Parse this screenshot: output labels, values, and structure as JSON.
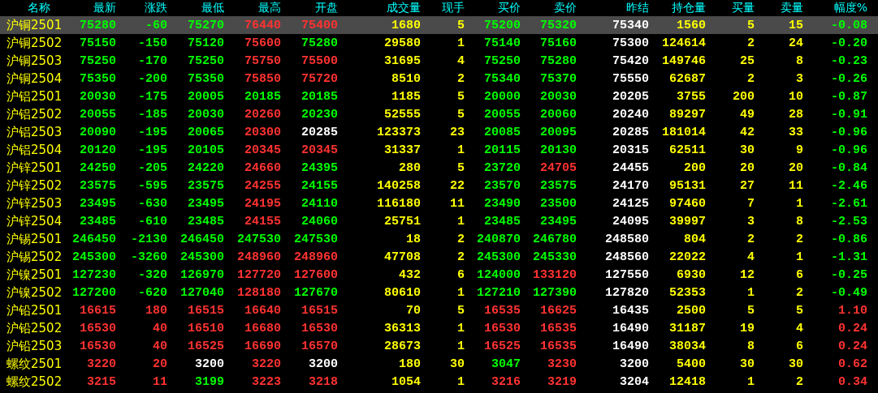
{
  "columns": [
    {
      "label": "名称"
    },
    {
      "label": "最新"
    },
    {
      "label": "涨跌"
    },
    {
      "label": "最低"
    },
    {
      "label": "最高"
    },
    {
      "label": "开盘"
    },
    {
      "label": "成交量"
    },
    {
      "label": "现手"
    },
    {
      "label": "买价"
    },
    {
      "label": "卖价"
    },
    {
      "label": "昨结"
    },
    {
      "label": "持仓量"
    },
    {
      "label": "买量"
    },
    {
      "label": "卖量"
    },
    {
      "label": "幅度%"
    }
  ],
  "rows": [
    {
      "selected": true,
      "cells": [
        {
          "text": "沪铜2501"
        },
        {
          "text": "75280",
          "color": "#00ff00"
        },
        {
          "text": "-60",
          "color": "#00ff00"
        },
        {
          "text": "75270",
          "color": "#00ff00"
        },
        {
          "text": "76440",
          "color": "#ff3232"
        },
        {
          "text": "75400",
          "color": "#ff3232"
        },
        {
          "text": "1680",
          "color": "#ffff00"
        },
        {
          "text": "5",
          "color": "#ffff00"
        },
        {
          "text": "75200",
          "color": "#00ff00"
        },
        {
          "text": "75320",
          "color": "#00ff00"
        },
        {
          "text": "75340",
          "color": "#ffffff"
        },
        {
          "text": "1560",
          "color": "#ffff00"
        },
        {
          "text": "5",
          "color": "#ffff00"
        },
        {
          "text": "15",
          "color": "#ffff00"
        },
        {
          "text": "-0.08",
          "color": "#00ff00"
        }
      ]
    },
    {
      "selected": false,
      "cells": [
        {
          "text": "沪铜2502"
        },
        {
          "text": "75150",
          "color": "#00ff00"
        },
        {
          "text": "-150",
          "color": "#00ff00"
        },
        {
          "text": "75120",
          "color": "#00ff00"
        },
        {
          "text": "75600",
          "color": "#ff3232"
        },
        {
          "text": "75280",
          "color": "#00ff00"
        },
        {
          "text": "29580",
          "color": "#ffff00"
        },
        {
          "text": "1",
          "color": "#ffff00"
        },
        {
          "text": "75140",
          "color": "#00ff00"
        },
        {
          "text": "75160",
          "color": "#00ff00"
        },
        {
          "text": "75300",
          "color": "#ffffff"
        },
        {
          "text": "124614",
          "color": "#ffff00"
        },
        {
          "text": "2",
          "color": "#ffff00"
        },
        {
          "text": "24",
          "color": "#ffff00"
        },
        {
          "text": "-0.20",
          "color": "#00ff00"
        }
      ]
    },
    {
      "selected": false,
      "cells": [
        {
          "text": "沪铜2503"
        },
        {
          "text": "75250",
          "color": "#00ff00"
        },
        {
          "text": "-170",
          "color": "#00ff00"
        },
        {
          "text": "75250",
          "color": "#00ff00"
        },
        {
          "text": "75750",
          "color": "#ff3232"
        },
        {
          "text": "75500",
          "color": "#ff3232"
        },
        {
          "text": "31695",
          "color": "#ffff00"
        },
        {
          "text": "4",
          "color": "#ffff00"
        },
        {
          "text": "75250",
          "color": "#00ff00"
        },
        {
          "text": "75280",
          "color": "#00ff00"
        },
        {
          "text": "75420",
          "color": "#ffffff"
        },
        {
          "text": "149746",
          "color": "#ffff00"
        },
        {
          "text": "25",
          "color": "#ffff00"
        },
        {
          "text": "8",
          "color": "#ffff00"
        },
        {
          "text": "-0.23",
          "color": "#00ff00"
        }
      ]
    },
    {
      "selected": false,
      "cells": [
        {
          "text": "沪铜2504"
        },
        {
          "text": "75350",
          "color": "#00ff00"
        },
        {
          "text": "-200",
          "color": "#00ff00"
        },
        {
          "text": "75350",
          "color": "#00ff00"
        },
        {
          "text": "75850",
          "color": "#ff3232"
        },
        {
          "text": "75720",
          "color": "#ff3232"
        },
        {
          "text": "8510",
          "color": "#ffff00"
        },
        {
          "text": "2",
          "color": "#ffff00"
        },
        {
          "text": "75340",
          "color": "#00ff00"
        },
        {
          "text": "75370",
          "color": "#00ff00"
        },
        {
          "text": "75550",
          "color": "#ffffff"
        },
        {
          "text": "62687",
          "color": "#ffff00"
        },
        {
          "text": "2",
          "color": "#ffff00"
        },
        {
          "text": "3",
          "color": "#ffff00"
        },
        {
          "text": "-0.26",
          "color": "#00ff00"
        }
      ]
    },
    {
      "selected": false,
      "cells": [
        {
          "text": "沪铝2501"
        },
        {
          "text": "20030",
          "color": "#00ff00"
        },
        {
          "text": "-175",
          "color": "#00ff00"
        },
        {
          "text": "20005",
          "color": "#00ff00"
        },
        {
          "text": "20185",
          "color": "#00ff00"
        },
        {
          "text": "20185",
          "color": "#00ff00"
        },
        {
          "text": "1185",
          "color": "#ffff00"
        },
        {
          "text": "5",
          "color": "#ffff00"
        },
        {
          "text": "20000",
          "color": "#00ff00"
        },
        {
          "text": "20030",
          "color": "#00ff00"
        },
        {
          "text": "20205",
          "color": "#ffffff"
        },
        {
          "text": "3755",
          "color": "#ffff00"
        },
        {
          "text": "200",
          "color": "#ffff00"
        },
        {
          "text": "10",
          "color": "#ffff00"
        },
        {
          "text": "-0.87",
          "color": "#00ff00"
        }
      ]
    },
    {
      "selected": false,
      "cells": [
        {
          "text": "沪铝2502"
        },
        {
          "text": "20055",
          "color": "#00ff00"
        },
        {
          "text": "-185",
          "color": "#00ff00"
        },
        {
          "text": "20030",
          "color": "#00ff00"
        },
        {
          "text": "20260",
          "color": "#ff3232"
        },
        {
          "text": "20230",
          "color": "#00ff00"
        },
        {
          "text": "52555",
          "color": "#ffff00"
        },
        {
          "text": "5",
          "color": "#ffff00"
        },
        {
          "text": "20055",
          "color": "#00ff00"
        },
        {
          "text": "20060",
          "color": "#00ff00"
        },
        {
          "text": "20240",
          "color": "#ffffff"
        },
        {
          "text": "89297",
          "color": "#ffff00"
        },
        {
          "text": "49",
          "color": "#ffff00"
        },
        {
          "text": "28",
          "color": "#ffff00"
        },
        {
          "text": "-0.91",
          "color": "#00ff00"
        }
      ]
    },
    {
      "selected": false,
      "cells": [
        {
          "text": "沪铝2503"
        },
        {
          "text": "20090",
          "color": "#00ff00"
        },
        {
          "text": "-195",
          "color": "#00ff00"
        },
        {
          "text": "20065",
          "color": "#00ff00"
        },
        {
          "text": "20300",
          "color": "#ff3232"
        },
        {
          "text": "20285",
          "color": "#ffffff"
        },
        {
          "text": "123373",
          "color": "#ffff00"
        },
        {
          "text": "23",
          "color": "#ffff00"
        },
        {
          "text": "20085",
          "color": "#00ff00"
        },
        {
          "text": "20095",
          "color": "#00ff00"
        },
        {
          "text": "20285",
          "color": "#ffffff"
        },
        {
          "text": "181014",
          "color": "#ffff00"
        },
        {
          "text": "42",
          "color": "#ffff00"
        },
        {
          "text": "33",
          "color": "#ffff00"
        },
        {
          "text": "-0.96",
          "color": "#00ff00"
        }
      ]
    },
    {
      "selected": false,
      "cells": [
        {
          "text": "沪铝2504"
        },
        {
          "text": "20120",
          "color": "#00ff00"
        },
        {
          "text": "-195",
          "color": "#00ff00"
        },
        {
          "text": "20105",
          "color": "#00ff00"
        },
        {
          "text": "20345",
          "color": "#ff3232"
        },
        {
          "text": "20345",
          "color": "#ff3232"
        },
        {
          "text": "31337",
          "color": "#ffff00"
        },
        {
          "text": "1",
          "color": "#ffff00"
        },
        {
          "text": "20115",
          "color": "#00ff00"
        },
        {
          "text": "20130",
          "color": "#00ff00"
        },
        {
          "text": "20315",
          "color": "#ffffff"
        },
        {
          "text": "62511",
          "color": "#ffff00"
        },
        {
          "text": "30",
          "color": "#ffff00"
        },
        {
          "text": "9",
          "color": "#ffff00"
        },
        {
          "text": "-0.96",
          "color": "#00ff00"
        }
      ]
    },
    {
      "selected": false,
      "cells": [
        {
          "text": "沪锌2501"
        },
        {
          "text": "24250",
          "color": "#00ff00"
        },
        {
          "text": "-205",
          "color": "#00ff00"
        },
        {
          "text": "24220",
          "color": "#00ff00"
        },
        {
          "text": "24660",
          "color": "#ff3232"
        },
        {
          "text": "24395",
          "color": "#00ff00"
        },
        {
          "text": "280",
          "color": "#ffff00"
        },
        {
          "text": "5",
          "color": "#ffff00"
        },
        {
          "text": "23720",
          "color": "#00ff00"
        },
        {
          "text": "24705",
          "color": "#ff3232"
        },
        {
          "text": "24455",
          "color": "#ffffff"
        },
        {
          "text": "200",
          "color": "#ffff00"
        },
        {
          "text": "20",
          "color": "#ffff00"
        },
        {
          "text": "20",
          "color": "#ffff00"
        },
        {
          "text": "-0.84",
          "color": "#00ff00"
        }
      ]
    },
    {
      "selected": false,
      "cells": [
        {
          "text": "沪锌2502"
        },
        {
          "text": "23575",
          "color": "#00ff00"
        },
        {
          "text": "-595",
          "color": "#00ff00"
        },
        {
          "text": "23575",
          "color": "#00ff00"
        },
        {
          "text": "24255",
          "color": "#ff3232"
        },
        {
          "text": "24155",
          "color": "#00ff00"
        },
        {
          "text": "140258",
          "color": "#ffff00"
        },
        {
          "text": "22",
          "color": "#ffff00"
        },
        {
          "text": "23570",
          "color": "#00ff00"
        },
        {
          "text": "23575",
          "color": "#00ff00"
        },
        {
          "text": "24170",
          "color": "#ffffff"
        },
        {
          "text": "95131",
          "color": "#ffff00"
        },
        {
          "text": "27",
          "color": "#ffff00"
        },
        {
          "text": "11",
          "color": "#ffff00"
        },
        {
          "text": "-2.46",
          "color": "#00ff00"
        }
      ]
    },
    {
      "selected": false,
      "cells": [
        {
          "text": "沪锌2503"
        },
        {
          "text": "23495",
          "color": "#00ff00"
        },
        {
          "text": "-630",
          "color": "#00ff00"
        },
        {
          "text": "23495",
          "color": "#00ff00"
        },
        {
          "text": "24195",
          "color": "#ff3232"
        },
        {
          "text": "24110",
          "color": "#00ff00"
        },
        {
          "text": "116180",
          "color": "#ffff00"
        },
        {
          "text": "11",
          "color": "#ffff00"
        },
        {
          "text": "23490",
          "color": "#00ff00"
        },
        {
          "text": "23500",
          "color": "#00ff00"
        },
        {
          "text": "24125",
          "color": "#ffffff"
        },
        {
          "text": "97460",
          "color": "#ffff00"
        },
        {
          "text": "7",
          "color": "#ffff00"
        },
        {
          "text": "1",
          "color": "#ffff00"
        },
        {
          "text": "-2.61",
          "color": "#00ff00"
        }
      ]
    },
    {
      "selected": false,
      "cells": [
        {
          "text": "沪锌2504"
        },
        {
          "text": "23485",
          "color": "#00ff00"
        },
        {
          "text": "-610",
          "color": "#00ff00"
        },
        {
          "text": "23485",
          "color": "#00ff00"
        },
        {
          "text": "24155",
          "color": "#ff3232"
        },
        {
          "text": "24060",
          "color": "#00ff00"
        },
        {
          "text": "25751",
          "color": "#ffff00"
        },
        {
          "text": "1",
          "color": "#ffff00"
        },
        {
          "text": "23485",
          "color": "#00ff00"
        },
        {
          "text": "23495",
          "color": "#00ff00"
        },
        {
          "text": "24095",
          "color": "#ffffff"
        },
        {
          "text": "39997",
          "color": "#ffff00"
        },
        {
          "text": "3",
          "color": "#ffff00"
        },
        {
          "text": "8",
          "color": "#ffff00"
        },
        {
          "text": "-2.53",
          "color": "#00ff00"
        }
      ]
    },
    {
      "selected": false,
      "cells": [
        {
          "text": "沪锡2501"
        },
        {
          "text": "246450",
          "color": "#00ff00"
        },
        {
          "text": "-2130",
          "color": "#00ff00"
        },
        {
          "text": "246450",
          "color": "#00ff00"
        },
        {
          "text": "247530",
          "color": "#00ff00"
        },
        {
          "text": "247530",
          "color": "#00ff00"
        },
        {
          "text": "18",
          "color": "#ffff00"
        },
        {
          "text": "2",
          "color": "#ffff00"
        },
        {
          "text": "240870",
          "color": "#00ff00"
        },
        {
          "text": "246780",
          "color": "#00ff00"
        },
        {
          "text": "248580",
          "color": "#ffffff"
        },
        {
          "text": "804",
          "color": "#ffff00"
        },
        {
          "text": "2",
          "color": "#ffff00"
        },
        {
          "text": "2",
          "color": "#ffff00"
        },
        {
          "text": "-0.86",
          "color": "#00ff00"
        }
      ]
    },
    {
      "selected": false,
      "cells": [
        {
          "text": "沪锡2502"
        },
        {
          "text": "245300",
          "color": "#00ff00"
        },
        {
          "text": "-3260",
          "color": "#00ff00"
        },
        {
          "text": "245300",
          "color": "#00ff00"
        },
        {
          "text": "248960",
          "color": "#ff3232"
        },
        {
          "text": "248960",
          "color": "#ff3232"
        },
        {
          "text": "47708",
          "color": "#ffff00"
        },
        {
          "text": "2",
          "color": "#ffff00"
        },
        {
          "text": "245300",
          "color": "#00ff00"
        },
        {
          "text": "245330",
          "color": "#00ff00"
        },
        {
          "text": "248560",
          "color": "#ffffff"
        },
        {
          "text": "22022",
          "color": "#ffff00"
        },
        {
          "text": "4",
          "color": "#ffff00"
        },
        {
          "text": "1",
          "color": "#ffff00"
        },
        {
          "text": "-1.31",
          "color": "#00ff00"
        }
      ]
    },
    {
      "selected": false,
      "cells": [
        {
          "text": "沪镍2501"
        },
        {
          "text": "127230",
          "color": "#00ff00"
        },
        {
          "text": "-320",
          "color": "#00ff00"
        },
        {
          "text": "126970",
          "color": "#00ff00"
        },
        {
          "text": "127720",
          "color": "#ff3232"
        },
        {
          "text": "127600",
          "color": "#ff3232"
        },
        {
          "text": "432",
          "color": "#ffff00"
        },
        {
          "text": "6",
          "color": "#ffff00"
        },
        {
          "text": "124000",
          "color": "#00ff00"
        },
        {
          "text": "133120",
          "color": "#ff3232"
        },
        {
          "text": "127550",
          "color": "#ffffff"
        },
        {
          "text": "6930",
          "color": "#ffff00"
        },
        {
          "text": "12",
          "color": "#ffff00"
        },
        {
          "text": "6",
          "color": "#ffff00"
        },
        {
          "text": "-0.25",
          "color": "#00ff00"
        }
      ]
    },
    {
      "selected": false,
      "cells": [
        {
          "text": "沪镍2502"
        },
        {
          "text": "127200",
          "color": "#00ff00"
        },
        {
          "text": "-620",
          "color": "#00ff00"
        },
        {
          "text": "127040",
          "color": "#00ff00"
        },
        {
          "text": "128180",
          "color": "#ff3232"
        },
        {
          "text": "127670",
          "color": "#00ff00"
        },
        {
          "text": "80610",
          "color": "#ffff00"
        },
        {
          "text": "1",
          "color": "#ffff00"
        },
        {
          "text": "127210",
          "color": "#00ff00"
        },
        {
          "text": "127390",
          "color": "#00ff00"
        },
        {
          "text": "127820",
          "color": "#ffffff"
        },
        {
          "text": "52353",
          "color": "#ffff00"
        },
        {
          "text": "1",
          "color": "#ffff00"
        },
        {
          "text": "2",
          "color": "#ffff00"
        },
        {
          "text": "-0.49",
          "color": "#00ff00"
        }
      ]
    },
    {
      "selected": false,
      "cells": [
        {
          "text": "沪铅2501"
        },
        {
          "text": "16615",
          "color": "#ff3232"
        },
        {
          "text": "180",
          "color": "#ff3232"
        },
        {
          "text": "16515",
          "color": "#ff3232"
        },
        {
          "text": "16640",
          "color": "#ff3232"
        },
        {
          "text": "16515",
          "color": "#ff3232"
        },
        {
          "text": "70",
          "color": "#ffff00"
        },
        {
          "text": "5",
          "color": "#ffff00"
        },
        {
          "text": "16535",
          "color": "#ff3232"
        },
        {
          "text": "16625",
          "color": "#ff3232"
        },
        {
          "text": "16435",
          "color": "#ffffff"
        },
        {
          "text": "2500",
          "color": "#ffff00"
        },
        {
          "text": "5",
          "color": "#ffff00"
        },
        {
          "text": "5",
          "color": "#ffff00"
        },
        {
          "text": "1.10",
          "color": "#ff3232"
        }
      ]
    },
    {
      "selected": false,
      "cells": [
        {
          "text": "沪铅2502"
        },
        {
          "text": "16530",
          "color": "#ff3232"
        },
        {
          "text": "40",
          "color": "#ff3232"
        },
        {
          "text": "16510",
          "color": "#ff3232"
        },
        {
          "text": "16680",
          "color": "#ff3232"
        },
        {
          "text": "16530",
          "color": "#ff3232"
        },
        {
          "text": "36313",
          "color": "#ffff00"
        },
        {
          "text": "1",
          "color": "#ffff00"
        },
        {
          "text": "16530",
          "color": "#ff3232"
        },
        {
          "text": "16535",
          "color": "#ff3232"
        },
        {
          "text": "16490",
          "color": "#ffffff"
        },
        {
          "text": "31187",
          "color": "#ffff00"
        },
        {
          "text": "19",
          "color": "#ffff00"
        },
        {
          "text": "4",
          "color": "#ffff00"
        },
        {
          "text": "0.24",
          "color": "#ff3232"
        }
      ]
    },
    {
      "selected": false,
      "cells": [
        {
          "text": "沪铅2503"
        },
        {
          "text": "16530",
          "color": "#ff3232"
        },
        {
          "text": "40",
          "color": "#ff3232"
        },
        {
          "text": "16525",
          "color": "#ff3232"
        },
        {
          "text": "16690",
          "color": "#ff3232"
        },
        {
          "text": "16570",
          "color": "#ff3232"
        },
        {
          "text": "28673",
          "color": "#ffff00"
        },
        {
          "text": "1",
          "color": "#ffff00"
        },
        {
          "text": "16525",
          "color": "#ff3232"
        },
        {
          "text": "16535",
          "color": "#ff3232"
        },
        {
          "text": "16490",
          "color": "#ffffff"
        },
        {
          "text": "38034",
          "color": "#ffff00"
        },
        {
          "text": "8",
          "color": "#ffff00"
        },
        {
          "text": "6",
          "color": "#ffff00"
        },
        {
          "text": "0.24",
          "color": "#ff3232"
        }
      ]
    },
    {
      "selected": false,
      "cells": [
        {
          "text": "螺纹2501"
        },
        {
          "text": "3220",
          "color": "#ff3232"
        },
        {
          "text": "20",
          "color": "#ff3232"
        },
        {
          "text": "3200",
          "color": "#ffffff"
        },
        {
          "text": "3220",
          "color": "#ff3232"
        },
        {
          "text": "3200",
          "color": "#ffffff"
        },
        {
          "text": "180",
          "color": "#ffff00"
        },
        {
          "text": "30",
          "color": "#ffff00"
        },
        {
          "text": "3047",
          "color": "#00ff00"
        },
        {
          "text": "3230",
          "color": "#ff3232"
        },
        {
          "text": "3200",
          "color": "#ffffff"
        },
        {
          "text": "5400",
          "color": "#ffff00"
        },
        {
          "text": "30",
          "color": "#ffff00"
        },
        {
          "text": "30",
          "color": "#ffff00"
        },
        {
          "text": "0.62",
          "color": "#ff3232"
        }
      ]
    },
    {
      "selected": false,
      "cells": [
        {
          "text": "螺纹2502"
        },
        {
          "text": "3215",
          "color": "#ff3232"
        },
        {
          "text": "11",
          "color": "#ff3232"
        },
        {
          "text": "3199",
          "color": "#00ff00"
        },
        {
          "text": "3223",
          "color": "#ff3232"
        },
        {
          "text": "3218",
          "color": "#ff3232"
        },
        {
          "text": "1054",
          "color": "#ffff00"
        },
        {
          "text": "1",
          "color": "#ffff00"
        },
        {
          "text": "3216",
          "color": "#ff3232"
        },
        {
          "text": "3219",
          "color": "#ff3232"
        },
        {
          "text": "3204",
          "color": "#ffffff"
        },
        {
          "text": "12418",
          "color": "#ffff00"
        },
        {
          "text": "1",
          "color": "#ffff00"
        },
        {
          "text": "2",
          "color": "#ffff00"
        },
        {
          "text": "0.34",
          "color": "#ff3232"
        }
      ]
    }
  ]
}
